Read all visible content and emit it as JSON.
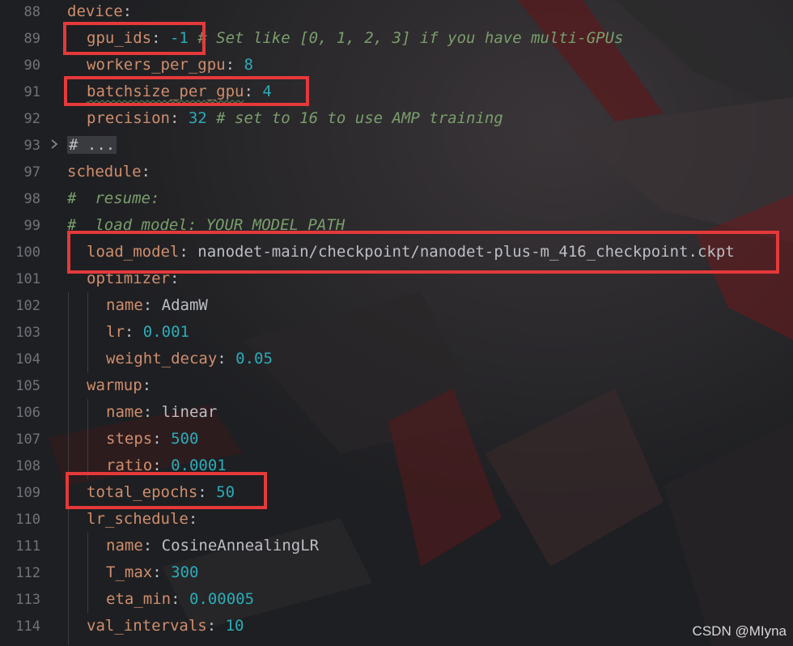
{
  "editor": {
    "lines": [
      {
        "num": "88",
        "indent": 0,
        "key": "device",
        "sep": ":",
        "value": "",
        "value_type": "",
        "comment": ""
      },
      {
        "num": "89",
        "indent": 1,
        "key": "gpu_ids",
        "sep": ": ",
        "value": "-1",
        "value_type": "num",
        "comment": " # Set like [0, 1, 2, 3] if you have multi-GPUs"
      },
      {
        "num": "90",
        "indent": 1,
        "key": "workers_per_gpu",
        "sep": ": ",
        "value": "8",
        "value_type": "num",
        "comment": ""
      },
      {
        "num": "91",
        "indent": 1,
        "key": "batchsize_per_gpu",
        "sep": ": ",
        "value": "4",
        "value_type": "num",
        "comment": ""
      },
      {
        "num": "92",
        "indent": 1,
        "key": "precision",
        "sep": ": ",
        "value": "32",
        "value_type": "num",
        "comment": " # set to 16 to use AMP training"
      },
      {
        "num": "93",
        "indent": 0,
        "key": "",
        "sep": "",
        "value": "",
        "value_type": "",
        "comment": "",
        "collapsed": "# ..."
      },
      {
        "num": "97",
        "indent": 0,
        "key": "schedule",
        "sep": ":",
        "value": "",
        "value_type": "",
        "comment": ""
      },
      {
        "num": "98",
        "indent": 0,
        "key": "",
        "sep": "",
        "value": "",
        "value_type": "",
        "comment": "#  resume:"
      },
      {
        "num": "99",
        "indent": 0,
        "key": "",
        "sep": "",
        "value": "",
        "value_type": "",
        "comment": "#  load_model: YOUR_MODEL_PATH"
      },
      {
        "num": "100",
        "indent": 1,
        "key": "load_model",
        "sep": ": ",
        "value": "nanodet-main/checkpoint/nanodet-plus-m_416_checkpoint.ckpt",
        "value_type": "str",
        "comment": ""
      },
      {
        "num": "101",
        "indent": 1,
        "key": "optimizer",
        "sep": ":",
        "value": "",
        "value_type": "",
        "comment": ""
      },
      {
        "num": "102",
        "indent": 2,
        "key": "name",
        "sep": ": ",
        "value": "AdamW",
        "value_type": "str",
        "comment": ""
      },
      {
        "num": "103",
        "indent": 2,
        "key": "lr",
        "sep": ": ",
        "value": "0.001",
        "value_type": "num",
        "comment": ""
      },
      {
        "num": "104",
        "indent": 2,
        "key": "weight_decay",
        "sep": ": ",
        "value": "0.05",
        "value_type": "num",
        "comment": ""
      },
      {
        "num": "105",
        "indent": 1,
        "key": "warmup",
        "sep": ":",
        "value": "",
        "value_type": "",
        "comment": ""
      },
      {
        "num": "106",
        "indent": 2,
        "key": "name",
        "sep": ": ",
        "value": "linear",
        "value_type": "str",
        "comment": ""
      },
      {
        "num": "107",
        "indent": 2,
        "key": "steps",
        "sep": ": ",
        "value": "500",
        "value_type": "num",
        "comment": ""
      },
      {
        "num": "108",
        "indent": 2,
        "key": "ratio",
        "sep": ": ",
        "value": "0.0001",
        "value_type": "num",
        "comment": ""
      },
      {
        "num": "109",
        "indent": 1,
        "key": "total_epochs",
        "sep": ": ",
        "value": "50",
        "value_type": "num",
        "comment": ""
      },
      {
        "num": "110",
        "indent": 1,
        "key": "lr_schedule",
        "sep": ":",
        "value": "",
        "value_type": "",
        "comment": ""
      },
      {
        "num": "111",
        "indent": 2,
        "key": "name",
        "sep": ": ",
        "value": "CosineAnnealingLR",
        "value_type": "str",
        "comment": ""
      },
      {
        "num": "112",
        "indent": 2,
        "key": "T_max",
        "sep": ": ",
        "value": "300",
        "value_type": "num",
        "comment": ""
      },
      {
        "num": "113",
        "indent": 2,
        "key": "eta_min",
        "sep": ": ",
        "value": "0.00005",
        "value_type": "num",
        "comment": ""
      },
      {
        "num": "114",
        "indent": 1,
        "key": "val_intervals",
        "sep": ": ",
        "value": "10",
        "value_type": "num",
        "comment": ""
      }
    ]
  },
  "watermark": "CSDN @MIyna",
  "colors": {
    "key": "#cf8e6d",
    "comment": "#7a9e6c",
    "highlight_box": "#e5393a",
    "background": "#1e1f22"
  }
}
